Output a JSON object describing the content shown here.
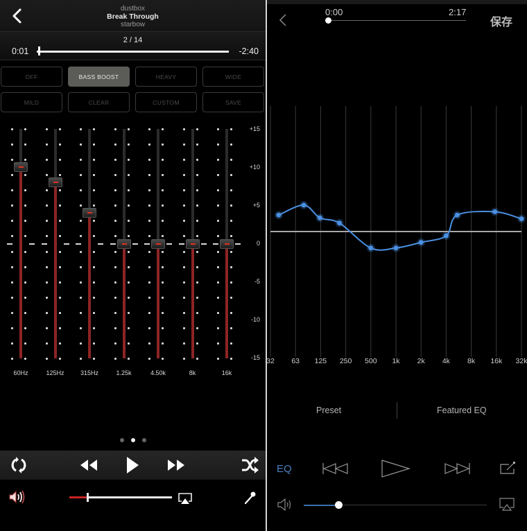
{
  "left_player": {
    "header": {
      "back_icon": "chevron-left-icon",
      "artist": "dustbox",
      "title": "Break Through",
      "album": "starbow"
    },
    "progress": {
      "track_count": "2 / 14",
      "elapsed": "0:01",
      "remaining": "-2:40",
      "fraction": 0.006
    },
    "presets": [
      {
        "label": "OFF",
        "active": false
      },
      {
        "label": "BASS BOOST",
        "active": true
      },
      {
        "label": "HEAVY",
        "active": false
      },
      {
        "label": "WIDE",
        "active": false
      },
      {
        "label": "MILD",
        "active": false
      },
      {
        "label": "CLEAR",
        "active": false
      },
      {
        "label": "CUSTOM",
        "active": false
      },
      {
        "label": "SAVE",
        "active": false
      }
    ],
    "equalizer": {
      "range_db": [
        -15,
        15
      ],
      "db_labels": [
        "+15",
        "+10",
        "+5",
        "0",
        "-5",
        "-10",
        "-15"
      ],
      "bands": [
        {
          "label": "60Hz",
          "gain_db": 10
        },
        {
          "label": "125Hz",
          "gain_db": 8
        },
        {
          "label": "315Hz",
          "gain_db": 4
        },
        {
          "label": "1.25k",
          "gain_db": 0
        },
        {
          "label": "4.50k",
          "gain_db": 0
        },
        {
          "label": "8k",
          "gain_db": 0
        },
        {
          "label": "16k",
          "gain_db": 0
        }
      ],
      "slider_track_color": "#8c2424",
      "thumb_indicator_color": "#e0301e"
    },
    "pager": {
      "count": 3,
      "active_index": 1
    },
    "transport": {
      "repeat_icon": "repeat-icon",
      "rewind_icon": "rewind-icon",
      "play_icon": "play-icon",
      "fast_forward_icon": "fast-forward-icon",
      "shuffle_icon": "shuffle-icon"
    },
    "volume": {
      "icon": "speaker-loud-icon",
      "level": 0.17,
      "fill_color": "#c62424",
      "airplay_icon": "airplay-icon",
      "mic_icon": "microphone-icon"
    }
  },
  "right_player": {
    "header": {
      "back_icon": "chevron-left-icon",
      "time_start": "0:00",
      "time_end": "2:17",
      "position_fraction": 0.0,
      "save_label": "保存"
    },
    "eq_curve": {
      "frequency_labels": [
        "32",
        "63",
        "125",
        "250",
        "500",
        "1k",
        "2k",
        "4k",
        "8k",
        "16k",
        "32k"
      ],
      "curve_color": "#4a90e2",
      "points": [
        {
          "freq_index": 0.33,
          "gain": 3.5
        },
        {
          "freq_index": 1.33,
          "gain": 5.6
        },
        {
          "freq_index": 1.97,
          "gain": 2.9
        },
        {
          "freq_index": 2.75,
          "gain": 1.8
        },
        {
          "freq_index": 4.0,
          "gain": -3.5
        },
        {
          "freq_index": 5.0,
          "gain": -3.5
        },
        {
          "freq_index": 6.0,
          "gain": -2.3
        },
        {
          "freq_index": 7.0,
          "gain": -0.9
        },
        {
          "freq_index": 7.44,
          "gain": 3.5
        },
        {
          "freq_index": 8.94,
          "gain": 4.2
        },
        {
          "freq_index": 10.0,
          "gain": 2.7
        }
      ],
      "gain_range": [
        -10,
        10
      ]
    },
    "tabs": [
      {
        "label": "Preset"
      },
      {
        "label": "Featured EQ"
      }
    ],
    "controls": {
      "eq_label": "EQ",
      "eq_color": "#4a7fc1",
      "previous_icon": "skip-previous-icon",
      "play_icon": "play-icon",
      "next_icon": "skip-next-icon",
      "share_icon": "share-icon"
    },
    "volume": {
      "icon": "speaker-icon",
      "level": 0.19,
      "fill_color": "#3b6fb0",
      "airplay_icon": "airplay-icon"
    }
  }
}
